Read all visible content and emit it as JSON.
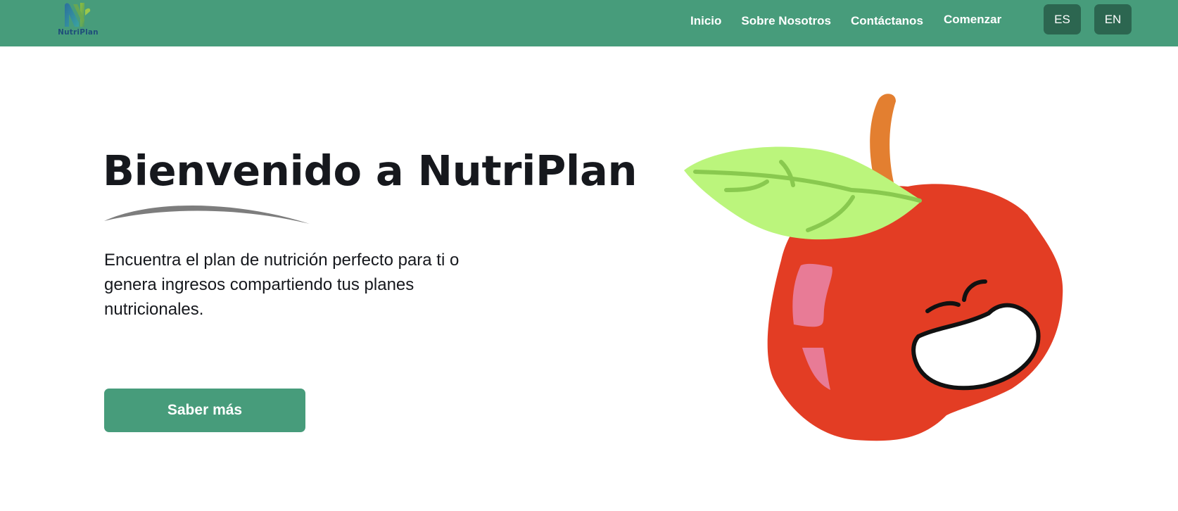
{
  "header": {
    "logo_text": "NutriPlan",
    "nav": [
      {
        "label": "Inicio"
      },
      {
        "label": "Sobre Nosotros"
      },
      {
        "label": "Contáctanos"
      }
    ],
    "cta_label": "Comenzar",
    "languages": [
      {
        "label": "ES"
      },
      {
        "label": "EN"
      }
    ]
  },
  "hero": {
    "title": "Bienvenido a NutriPlan",
    "description": "Encuentra el plan de nutrición perfecto para ti o genera ingresos compartiendo tus planes nutricionales.",
    "button_label": "Saber más"
  },
  "colors": {
    "brand_green": "#479c7b",
    "language_button": "#2c6650",
    "apple_red": "#e33d24",
    "leaf_green": "#bbf57c",
    "stem_orange": "#e37f30"
  },
  "icons": {
    "logo": "nutriplan-logo-icon",
    "illustration": "smiling-apple-illustration"
  }
}
